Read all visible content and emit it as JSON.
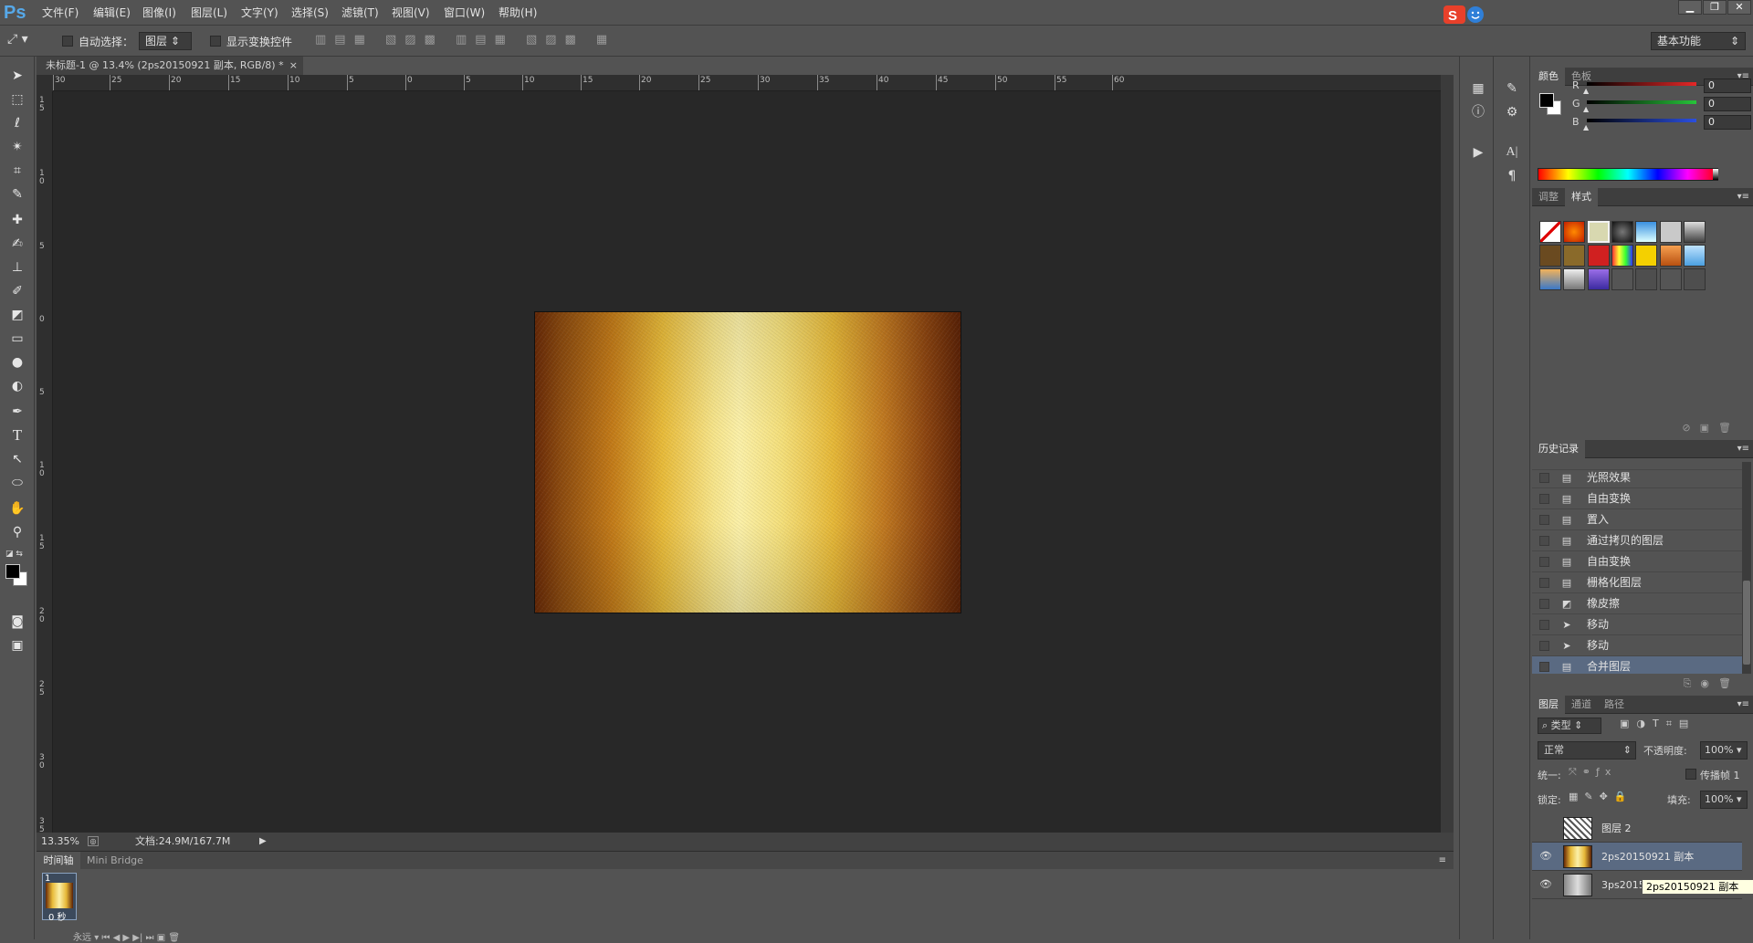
{
  "app": {
    "logo": "Ps"
  },
  "menu": [
    "文件(F)",
    "编辑(E)",
    "图像(I)",
    "图层(L)",
    "文字(Y)",
    "选择(S)",
    "滤镜(T)",
    "视图(V)",
    "窗口(W)",
    "帮助(H)"
  ],
  "window_buttons": [
    "▁",
    "❐",
    "✕"
  ],
  "options": {
    "auto_select_label": "自动选择：",
    "auto_select_value": "图层",
    "show_transform_label": "显示变换控件",
    "workspace": "基本功能"
  },
  "document": {
    "tab_title": "未标题-1 @ 13.4% (2ps20150921 副本, RGB/8) *",
    "zoom": "13.35%",
    "doc_info": "文档:24.9M/167.7M"
  },
  "ruler": {
    "top": [
      "30",
      "25",
      "20",
      "15",
      "10",
      "5",
      "0",
      "5",
      "10",
      "15",
      "20",
      "25",
      "30",
      "35",
      "40",
      "45",
      "50",
      "55",
      "60"
    ],
    "left": [
      "1 5",
      "1 0",
      "5",
      "0",
      "5",
      "1 0",
      "1 5",
      "2 0",
      "2 5",
      "3 0",
      "3 5"
    ]
  },
  "timeline": {
    "tabs": [
      "时间轴",
      "Mini Bridge"
    ],
    "frame_number": "1",
    "frame_delay": "0 秒",
    "loop": "永远"
  },
  "color_panel": {
    "tabs": [
      "颜色",
      "色板"
    ],
    "channels": [
      {
        "label": "R",
        "value": "0",
        "color": "#e52727"
      },
      {
        "label": "G",
        "value": "0",
        "color": "#27c43a"
      },
      {
        "label": "B",
        "value": "0",
        "color": "#2b4fe0"
      }
    ]
  },
  "styles_panel": {
    "tabs": [
      "调整",
      "样式"
    ]
  },
  "history_panel": {
    "title": "历史记录",
    "items": [
      {
        "label": "光照效果",
        "icon": "doc-icon"
      },
      {
        "label": "自由变换",
        "icon": "doc-icon"
      },
      {
        "label": "置入",
        "icon": "doc-icon"
      },
      {
        "label": "通过拷贝的图层",
        "icon": "doc-icon"
      },
      {
        "label": "自由变换",
        "icon": "doc-icon"
      },
      {
        "label": "栅格化图层",
        "icon": "doc-icon"
      },
      {
        "label": "橡皮擦",
        "icon": "eraser-icon"
      },
      {
        "label": "移动",
        "icon": "move-icon"
      },
      {
        "label": "移动",
        "icon": "move-icon"
      },
      {
        "label": "合并图层",
        "icon": "doc-icon"
      }
    ]
  },
  "layers_panel": {
    "tabs": [
      "图层",
      "通道",
      "路径"
    ],
    "filter": "类型",
    "blend_mode": "正常",
    "opacity_label": "不透明度:",
    "opacity": "100%",
    "unify_label": "统一:",
    "propagate_label": "传播帧 1",
    "lock_label": "锁定:",
    "fill_label": "填充:",
    "fill": "100%",
    "layers": [
      {
        "name": "图层 2",
        "visible": false
      },
      {
        "name": "2ps20150921 副本",
        "visible": true
      },
      {
        "name": "3ps2015",
        "visible": true
      }
    ],
    "tooltip": "2ps20150921 副本"
  }
}
